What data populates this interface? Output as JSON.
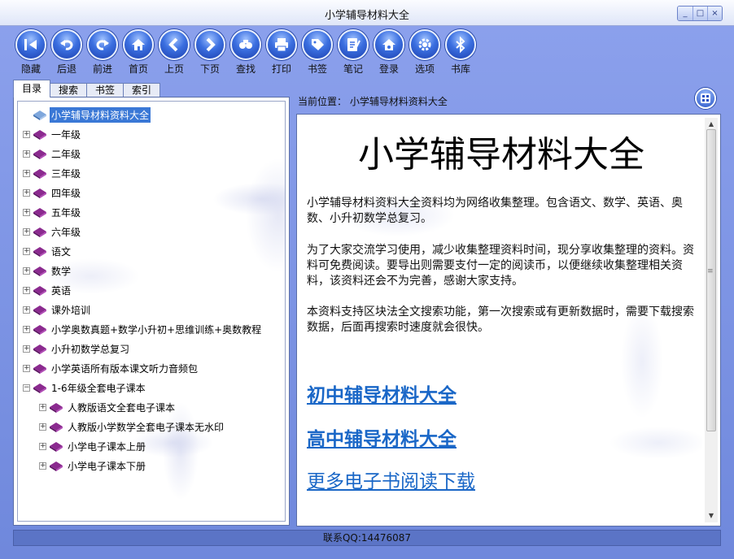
{
  "window": {
    "title": "小学辅导材料大全",
    "controls": [
      "_",
      "□",
      "×"
    ]
  },
  "toolbar": [
    {
      "label": "隐藏",
      "icon": "hide-icon"
    },
    {
      "label": "后退",
      "icon": "back-icon"
    },
    {
      "label": "前进",
      "icon": "forward-icon"
    },
    {
      "label": "首页",
      "icon": "home-icon"
    },
    {
      "label": "上页",
      "icon": "prev-page-icon"
    },
    {
      "label": "下页",
      "icon": "next-page-icon"
    },
    {
      "label": "查找",
      "icon": "find-icon"
    },
    {
      "label": "打印",
      "icon": "print-icon"
    },
    {
      "label": "书签",
      "icon": "bookmark-icon"
    },
    {
      "label": "笔记",
      "icon": "note-icon"
    },
    {
      "label": "登录",
      "icon": "login-icon"
    },
    {
      "label": "选项",
      "icon": "options-icon"
    },
    {
      "label": "书库",
      "icon": "library-icon"
    }
  ],
  "tabs": [
    "目录",
    "搜索",
    "书签",
    "索引"
  ],
  "tree": {
    "root": "小学辅导材料资料大全",
    "items": [
      "一年级",
      "二年级",
      "三年级",
      "四年级",
      "五年级",
      "六年级",
      "语文",
      "数学",
      "英语",
      "课外培训",
      "小学奥数真题+数学小升初+思维训练+奥数教程",
      "小升初数学总复习",
      "小学英语所有版本课文听力音频包"
    ],
    "expanded": "1-6年级全套电子课本",
    "children": [
      "人教版语文全套电子课本",
      "人教版小学数学全套电子课本无水印",
      "小学电子课本上册",
      "小学电子课本下册"
    ]
  },
  "content": {
    "breadcrumb": "当前位置：  小学辅导材料资料大全",
    "title": "小学辅导材料大全",
    "paragraphs": [
      "小学辅导材料资料大全资料均为网络收集整理。包含语文、数学、英语、奥数、小升初数学总复习。",
      "为了大家交流学习使用，减少收集整理资料时间，现分享收集整理的资料。资料可免费阅读。要导出则需要支付一定的阅读币，以便继续收集整理相关资料，该资料还会不为完善，感谢大家支持。",
      "本资料支持区块法全文搜索功能，第一次搜索或有更新数据时，需要下载搜索数据，后面再搜索时速度就会很快。"
    ],
    "links": [
      "初中辅导材料大全",
      "高中辅导材料大全",
      "更多电子书阅读下载"
    ]
  },
  "status": "联系QQ:14476087"
}
